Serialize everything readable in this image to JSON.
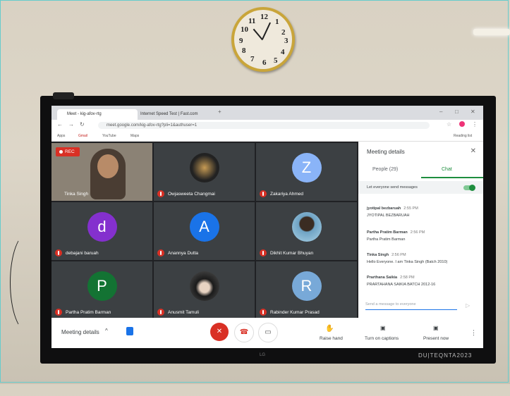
{
  "clock": {
    "numbers": [
      "12",
      "1",
      "2",
      "3",
      "4",
      "5",
      "6",
      "7",
      "8",
      "9",
      "10",
      "11"
    ]
  },
  "tv": {
    "logo": "LG",
    "brand": "DU|TEQNTA2023"
  },
  "browser": {
    "tabs": [
      {
        "label": "Meet - kig-afov-rtg",
        "active": true
      },
      {
        "label": "Internet Speed Test | Fast.com",
        "active": false
      }
    ],
    "url": "meet.google.com/kig-afov-rtg?pli=1&authuser=1",
    "bookmarks": [
      "Apps",
      "Gmail",
      "YouTube",
      "Maps"
    ],
    "reading_list": "Reading list"
  },
  "meet": {
    "rec_label": "REC",
    "participants": [
      {
        "name": "Tinka Singh",
        "type": "photo",
        "color": "#c9c0b3"
      },
      {
        "name": "Owjasweeta Changmai",
        "type": "photo",
        "color": "#3b3b3b"
      },
      {
        "name": "Zakariya Ahmed",
        "type": "letter",
        "letter": "Z",
        "color": "#8ab4f8"
      },
      {
        "name": "debajani baruah",
        "type": "letter",
        "letter": "d",
        "color": "#8430ce"
      },
      {
        "name": "Anannya Dutta",
        "type": "letter",
        "letter": "A",
        "color": "#1a73e8"
      },
      {
        "name": "Dikhit Kumar Bhuyan",
        "type": "photo",
        "color": "#7aa7c7"
      },
      {
        "name": "Partha Pratim Barman",
        "type": "letter",
        "letter": "P",
        "color": "#137333"
      },
      {
        "name": "Anusmit Tamuli",
        "type": "photo",
        "color": "#444"
      },
      {
        "name": "Rabinder Kumar Prasad",
        "type": "letter",
        "letter": "R",
        "color": "#78a9d8"
      }
    ]
  },
  "panel": {
    "title": "Meeting details",
    "people_tab": "People (29)",
    "chat_tab": "Chat",
    "toggle_label": "Let everyone send messages",
    "messages": [
      {
        "who": "jyotipal bezbaruah",
        "time": "2:55 PM",
        "body": "JYOTIPAL BEZBARUAH"
      },
      {
        "who": "Partha Pratim Barman",
        "time": "2:56 PM",
        "body": "Partha Pratim Barman"
      },
      {
        "who": "Tinka Singh",
        "time": "2:56 PM",
        "body": "Hello Everyone. I am Tinka Singh (Batch 2010)"
      },
      {
        "who": "Prarthana Saikia",
        "time": "2:58 PM",
        "body": "PRARTAHANA SAIKIA BATCH 2012-16"
      }
    ],
    "input_placeholder": "Send a message to everyone"
  },
  "bar": {
    "meeting_details": "Meeting details",
    "raise_hand": "Raise hand",
    "captions": "Turn on captions",
    "present": "Present now"
  }
}
